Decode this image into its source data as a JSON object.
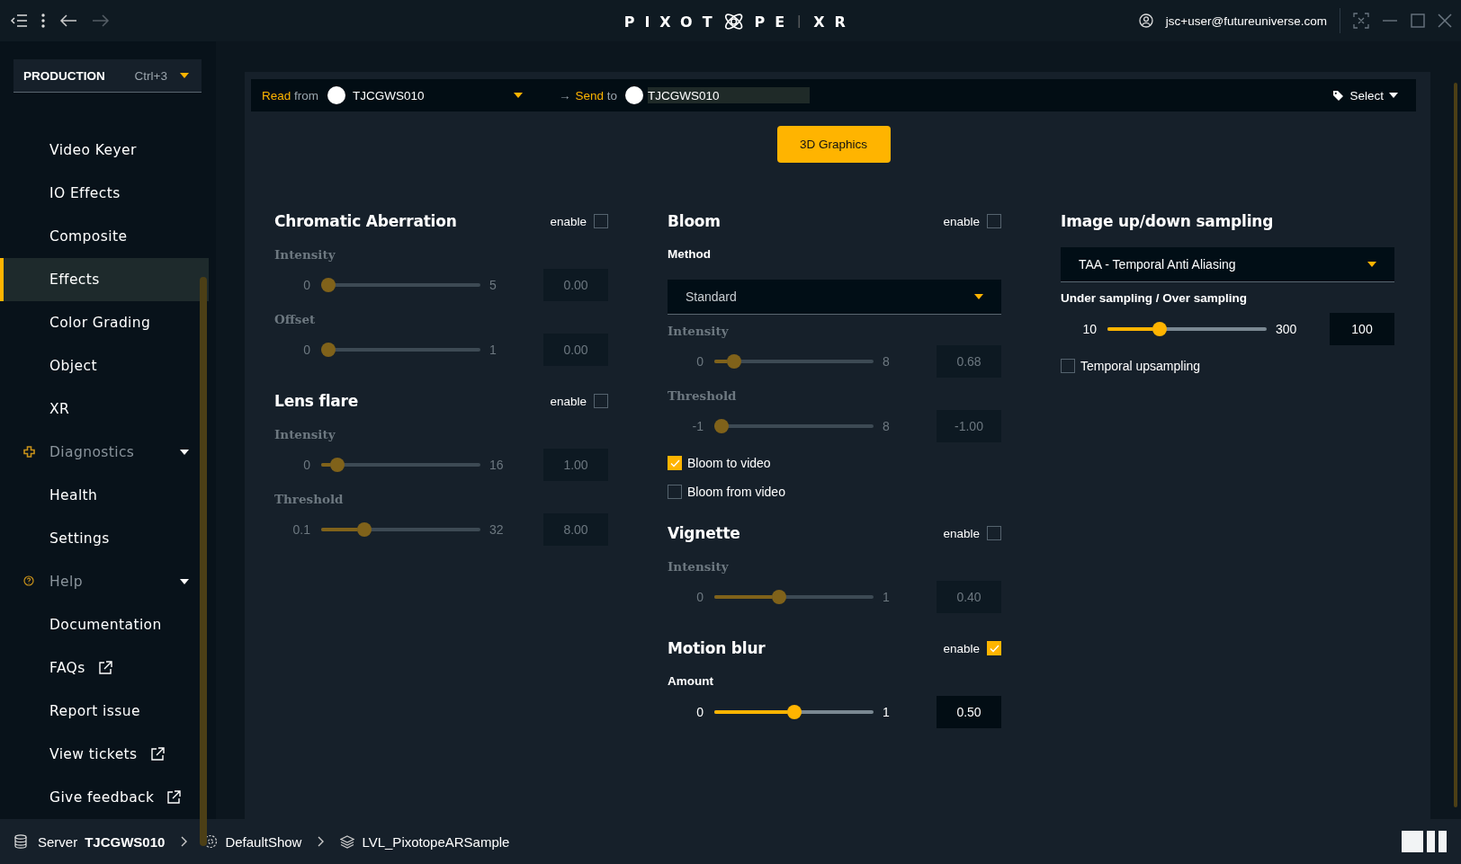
{
  "topbar": {
    "logo": {
      "left": "PIXOT",
      "right": "PE",
      "suffix": "XR"
    },
    "user": "jsc+user@futureuniverse.com"
  },
  "sidebar": {
    "mode": {
      "label": "PRODUCTION",
      "shortcut": "Ctrl+3"
    },
    "items": [
      {
        "label": "Video Keyer",
        "kind": "item",
        "selected": false
      },
      {
        "label": "IO Effects",
        "kind": "item",
        "selected": false
      },
      {
        "label": "Composite",
        "kind": "item",
        "selected": false
      },
      {
        "label": "Effects",
        "kind": "item",
        "selected": true
      },
      {
        "label": "Color Grading",
        "kind": "item",
        "selected": false
      },
      {
        "label": "Object",
        "kind": "item",
        "selected": false
      },
      {
        "label": "XR",
        "kind": "item",
        "selected": false
      },
      {
        "label": "Diagnostics",
        "kind": "group",
        "selected": false
      },
      {
        "label": "Health",
        "kind": "item",
        "selected": false
      },
      {
        "label": "Settings",
        "kind": "item",
        "selected": false
      },
      {
        "label": "Help",
        "kind": "group",
        "selected": false
      },
      {
        "label": "Documentation",
        "kind": "item",
        "selected": false
      },
      {
        "label": "FAQs",
        "kind": "external",
        "selected": false
      },
      {
        "label": "Report issue",
        "kind": "item",
        "selected": false
      },
      {
        "label": "View tickets",
        "kind": "external",
        "selected": false
      },
      {
        "label": "Give feedback",
        "kind": "external",
        "selected": false
      }
    ]
  },
  "source_bar": {
    "read_label": "Read",
    "read_from": "from",
    "read_device": "TJCGWS010",
    "send_arrow": "→",
    "send_label": "Send",
    "send_to": "to",
    "send_device": "TJCGWS010",
    "select": "Select"
  },
  "mode_button": "3D Graphics",
  "columns": [
    {
      "sections": [
        {
          "title": "Chromatic Aberration",
          "enable_label": "enable",
          "enabled": false,
          "controls": [
            {
              "kind": "slider",
              "label": "Intensity",
              "min": "0",
              "max": "5",
              "value": "0.00",
              "level": 0
            },
            {
              "kind": "slider",
              "label": "Offset",
              "min": "0",
              "max": "1",
              "value": "0.00",
              "level": 0
            }
          ]
        },
        {
          "title": "Lens flare",
          "enable_label": "enable",
          "enabled": false,
          "controls": [
            {
              "kind": "slider",
              "label": "Intensity",
              "min": "0",
              "max": "16",
              "value": "1.00",
              "level": 0.0625
            },
            {
              "kind": "slider",
              "label": "Threshold",
              "min": "0.1",
              "max": "32",
              "value": "8.00",
              "level": 0.25
            }
          ]
        }
      ]
    },
    {
      "sections": [
        {
          "title": "Bloom",
          "enable_label": "enable",
          "enabled": false,
          "controls": [
            {
              "kind": "dropdown",
              "label": "Method",
              "value": "Standard"
            },
            {
              "kind": "slider",
              "label": "Intensity",
              "min": "0",
              "max": "8",
              "value": "0.68",
              "level": 0.085
            },
            {
              "kind": "slider",
              "label": "Threshold",
              "min": "-1",
              "max": "8",
              "value": "-1.00",
              "level": 0
            },
            {
              "kind": "checkbox",
              "label": "Bloom to video",
              "checked": true
            },
            {
              "kind": "checkbox",
              "label": "Bloom from video",
              "checked": false
            }
          ]
        },
        {
          "title": "Vignette",
          "enable_label": "enable",
          "enabled": false,
          "controls": [
            {
              "kind": "slider",
              "label": "Intensity",
              "min": "0",
              "max": "1",
              "value": "0.40",
              "level": 0.4
            }
          ]
        },
        {
          "title": "Motion blur",
          "enable_label": "enable",
          "enabled": true,
          "controls": [
            {
              "kind": "slider",
              "label": "Amount",
              "min": "0",
              "max": "1",
              "value": "0.50",
              "level": 0.5
            }
          ]
        }
      ]
    },
    {
      "sections": [
        {
          "title": "Image up/down sampling",
          "controls": [
            {
              "kind": "dropdown",
              "value": "TAA - Temporal Anti Aliasing"
            },
            {
              "kind": "slider",
              "label": "Under sampling / Over sampling",
              "min": "10",
              "max": "300",
              "value": "100",
              "level": 0.31
            },
            {
              "kind": "checkbox",
              "label": "Temporal upsampling",
              "checked": false
            }
          ]
        }
      ]
    }
  ],
  "status_bar": {
    "server_label": "Server",
    "server": "TJCGWS010",
    "show": "DefaultShow",
    "level": "LVL_PixotopeARSample"
  }
}
